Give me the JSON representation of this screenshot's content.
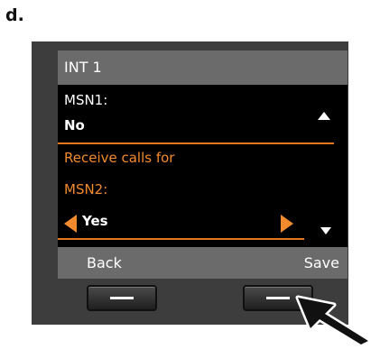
{
  "step_label": "d.",
  "screen": {
    "title": "INT 1",
    "rows": [
      {
        "text": "MSN1:"
      },
      {
        "text": "No"
      },
      {
        "text": "Receive calls for"
      },
      {
        "text": "MSN2:"
      },
      {
        "text": "Yes"
      }
    ]
  },
  "softkeys": {
    "left": "Back",
    "right": "Save"
  },
  "colors": {
    "accent": "#f28a2e",
    "bar": "#6b6b6b",
    "screen": "#000000",
    "device": "#3d3d3d"
  },
  "icons": [
    "scroll-up-icon",
    "scroll-down-icon",
    "arrow-left-icon",
    "arrow-right-icon",
    "pointer-arrow-icon"
  ]
}
